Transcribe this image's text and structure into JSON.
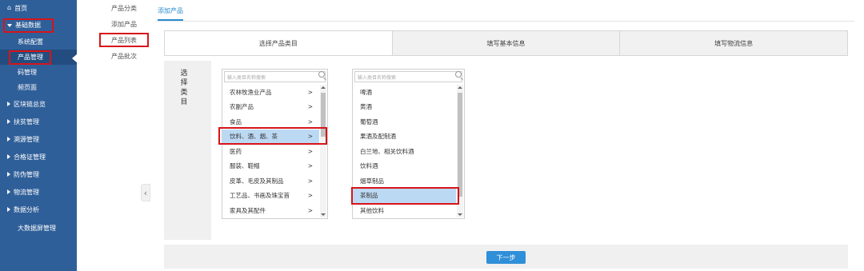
{
  "sidebar": {
    "home": "首页",
    "expanded_menu": "基础数据",
    "sub_items": [
      "系统配置",
      "产品管理",
      "码管理",
      "频页面"
    ],
    "menus": [
      "区块链总览",
      "扶贫管理",
      "溯源管理",
      "合格证管理",
      "防伪管理",
      "物流管理",
      "数据分析"
    ],
    "last_item": "大数据屏管理"
  },
  "submenu": {
    "items": [
      "产品分类",
      "添加产品",
      "产品列表",
      "产品批次"
    ]
  },
  "header": {
    "tab": "添加产品"
  },
  "steps": [
    "选择产品类目",
    "填写基本信息",
    "填写物流信息"
  ],
  "selector": {
    "label": "选择类目",
    "placeholder": "输入类目名称搜索",
    "arrow": ">",
    "level1": [
      "农林牧渔业产品",
      "农副产品",
      "食品",
      "饮料、酒、烟、茶",
      "医药",
      "服装、鞋帽",
      "皮革、毛皮及其制品",
      "工艺品、书画及珠宝首",
      "家具及其配件"
    ],
    "level2": [
      "啤酒",
      "黄酒",
      "葡萄酒",
      "果酒及配制酒",
      "白兰地、相关饮料酒",
      "饮料酒",
      "烟草制品",
      "茶制品",
      "其他饮料"
    ]
  },
  "footer": {
    "next": "下一步"
  },
  "colors": {
    "sidebar": "#2f5f99",
    "accent": "#2a8bd0",
    "selected": "#bcd9f3",
    "highlight_box": "#d7141a"
  }
}
